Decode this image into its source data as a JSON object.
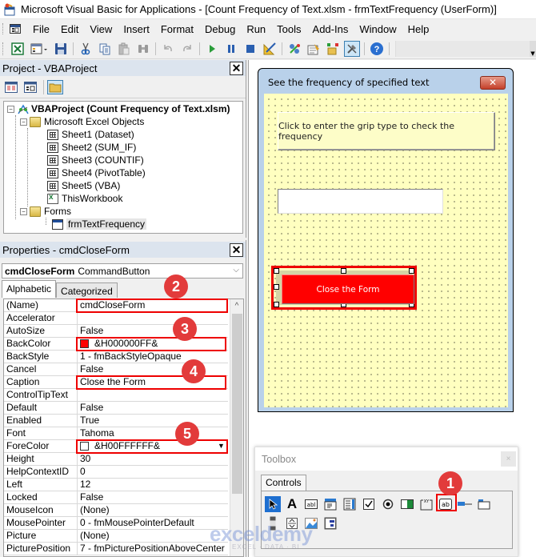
{
  "window": {
    "title": "Microsoft Visual Basic for Applications - [Count Frequency of Text.xlsm - frmTextFrequency (UserForm)]"
  },
  "menu": {
    "items": [
      {
        "label": "File",
        "accel": "F"
      },
      {
        "label": "Edit",
        "accel": "E"
      },
      {
        "label": "View",
        "accel": "V"
      },
      {
        "label": "Insert",
        "accel": "I"
      },
      {
        "label": "Format",
        "accel": "o"
      },
      {
        "label": "Debug",
        "accel": "D"
      },
      {
        "label": "Run",
        "accel": "R"
      },
      {
        "label": "Tools",
        "accel": "T"
      },
      {
        "label": "Add-Ins",
        "accel": "A"
      },
      {
        "label": "Window",
        "accel": "W"
      },
      {
        "label": "Help",
        "accel": "H"
      }
    ]
  },
  "toolbar": {
    "buttons": [
      "view-excel",
      "insert-userform",
      "save",
      "cut",
      "copy",
      "paste",
      "find",
      "undo",
      "redo",
      "run",
      "break",
      "reset",
      "design-mode",
      "project-explorer",
      "properties-window",
      "object-browser",
      "toolbox",
      "help"
    ]
  },
  "project": {
    "title": "Project - VBAProject",
    "close": "✕",
    "root": "VBAProject (Count Frequency of Text.xlsm)",
    "excel_objects_folder": "Microsoft Excel Objects",
    "sheets": [
      "Sheet1 (Dataset)",
      "Sheet2 (SUM_IF)",
      "Sheet3 (COUNTIF)",
      "Sheet4 (PivotTable)",
      "Sheet5 (VBA)"
    ],
    "workbook": "ThisWorkbook",
    "forms_folder": "Forms",
    "form": "frmTextFrequency"
  },
  "properties": {
    "title": "Properties - cmdCloseForm",
    "close": "✕",
    "object_name": "cmdCloseForm",
    "object_type": "CommandButton",
    "tabs": [
      "Alphabetic",
      "Categorized"
    ],
    "active_tab": "Alphabetic",
    "rows": [
      {
        "name": "(Name)",
        "value": "cmdCloseForm"
      },
      {
        "name": "Accelerator",
        "value": ""
      },
      {
        "name": "AutoSize",
        "value": "False"
      },
      {
        "name": "BackColor",
        "value": "&H000000FF&",
        "swatch": "#ff0000"
      },
      {
        "name": "BackStyle",
        "value": "1 - fmBackStyleOpaque"
      },
      {
        "name": "Cancel",
        "value": "False"
      },
      {
        "name": "Caption",
        "value": "Close the Form"
      },
      {
        "name": "ControlTipText",
        "value": ""
      },
      {
        "name": "Default",
        "value": "False"
      },
      {
        "name": "Enabled",
        "value": "True"
      },
      {
        "name": "Font",
        "value": "Tahoma"
      },
      {
        "name": "ForeColor",
        "value": "&H00FFFFFF&",
        "swatch": "#ffffff"
      },
      {
        "name": "Height",
        "value": "30"
      },
      {
        "name": "HelpContextID",
        "value": "0"
      },
      {
        "name": "Left",
        "value": "12"
      },
      {
        "name": "Locked",
        "value": "False"
      },
      {
        "name": "MouseIcon",
        "value": "(None)"
      },
      {
        "name": "MousePointer",
        "value": "0 - fmMousePointerDefault"
      },
      {
        "name": "Picture",
        "value": "(None)"
      },
      {
        "name": "PicturePosition",
        "value": "7 - fmPicturePositionAboveCenter"
      }
    ]
  },
  "userform": {
    "caption": "See the frequency of specified text",
    "close": "✕",
    "grip_button": "Click to enter the grip type to check the frequency",
    "textbox_value": "",
    "close_button": "Close the Form",
    "close_button_color": "#ff0000"
  },
  "toolbox": {
    "title": "Toolbox",
    "close": "×",
    "tab": "Controls",
    "items": [
      "Select Objects",
      "Label",
      "TextBox",
      "ComboBox",
      "ListBox",
      "CheckBox",
      "OptionButton",
      "ToggleButton",
      "Frame",
      "CommandButton",
      "TabStrip",
      "MultiPage",
      "ScrollBar",
      "SpinButton",
      "Image",
      "RefEdit"
    ]
  },
  "annotations": [
    {
      "number": "1",
      "target": "toolbox-commandbutton"
    },
    {
      "number": "2",
      "target": "prop-name"
    },
    {
      "number": "3",
      "target": "prop-backcolor"
    },
    {
      "number": "4",
      "target": "prop-caption"
    },
    {
      "number": "5",
      "target": "prop-forecolor"
    }
  ],
  "watermark": {
    "brand": "exceldemy",
    "tagline": "EXCEL · DATA · BI"
  }
}
